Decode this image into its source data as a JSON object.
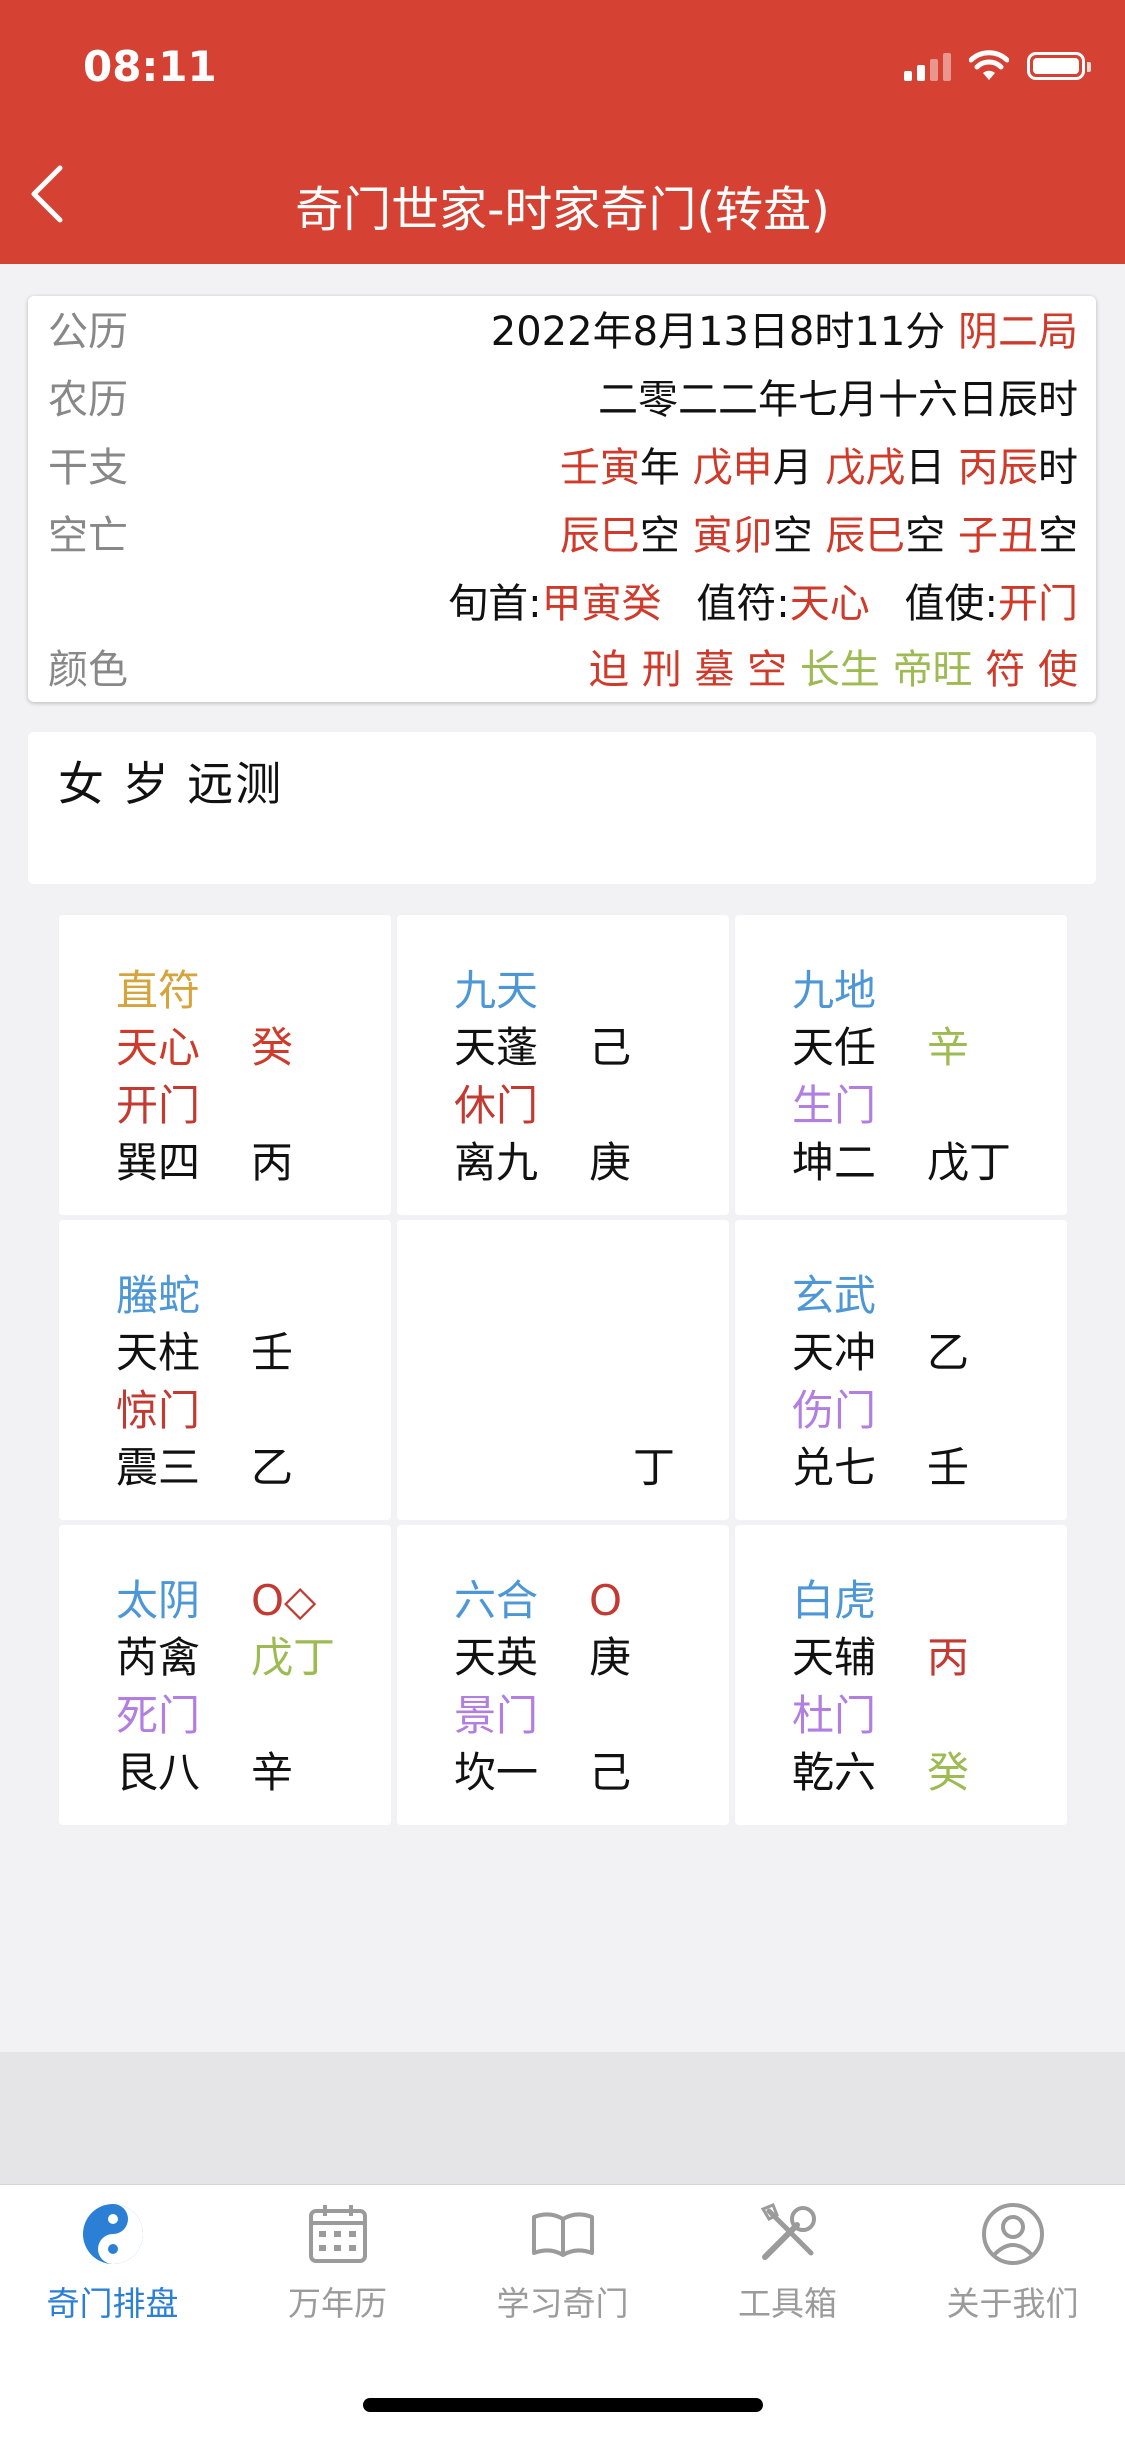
{
  "status_bar": {
    "time": "08:11"
  },
  "header": {
    "title": "奇门世家-时家奇门(转盘)"
  },
  "info": {
    "solar": {
      "label": "公历",
      "value": "2022年8月13日8时11分",
      "ju": "阴二局"
    },
    "lunar": {
      "label": "农历",
      "value": "二零二二年七月十六日辰时"
    },
    "ganzhi": {
      "label": "干支",
      "year": "壬寅",
      "year_unit": "年",
      "month": "戊申",
      "month_unit": "月",
      "day": "戊戌",
      "day_unit": "日",
      "hour": "丙辰",
      "hour_unit": "时"
    },
    "kongwang": {
      "label": "空亡",
      "items": [
        "辰巳",
        "寅卯",
        "辰巳",
        "子丑"
      ],
      "suffix": "空"
    },
    "xun": {
      "xunshou_label": "旬首:",
      "xunshou": "甲寅癸",
      "zhifu_label": "值符:",
      "zhifu": "天心",
      "zhishi_label": "值使:",
      "zhishi": "开门"
    },
    "colors": {
      "label": "颜色",
      "items": [
        "迫",
        "刑",
        "墓",
        "空",
        "长生",
        "帝旺",
        "符",
        "使"
      ]
    }
  },
  "question": "女 岁 远测",
  "palaces": [
    {
      "god": "直符",
      "star": "天心",
      "star_stem": "癸",
      "door": "开门",
      "palace": "巽四",
      "stem": "丙"
    },
    {
      "god": "九天",
      "star": "天蓬",
      "star_stem": "己",
      "door": "休门",
      "palace": "离九",
      "stem": "庚"
    },
    {
      "god": "九地",
      "star": "天任",
      "star_stem": "辛",
      "door": "生门",
      "palace": "坤二",
      "stem": "戊丁"
    },
    {
      "god": "螣蛇",
      "star": "天柱",
      "star_stem": "壬",
      "door": "惊门",
      "palace": "震三",
      "stem": "乙"
    },
    {
      "center_stem": "丁"
    },
    {
      "god": "玄武",
      "star": "天冲",
      "star_stem": "乙",
      "door": "伤门",
      "palace": "兑七",
      "stem": "壬"
    },
    {
      "god": "太阴",
      "mark": "O◇",
      "star": "芮禽",
      "star_stem": "戊丁",
      "door": "死门",
      "palace": "艮八",
      "stem": "辛"
    },
    {
      "god": "六合",
      "mark": "O",
      "star": "天英",
      "star_stem": "庚",
      "door": "景门",
      "palace": "坎一",
      "stem": "己"
    },
    {
      "god": "白虎",
      "star": "天辅",
      "star_stem": "丙",
      "door": "杜门",
      "palace": "乾六",
      "stem": "癸"
    }
  ],
  "tabs": [
    {
      "label": "奇门排盘",
      "icon": "yin-yang-icon",
      "active": true
    },
    {
      "label": "万年历",
      "icon": "calendar-icon"
    },
    {
      "label": "学习奇门",
      "icon": "book-icon"
    },
    {
      "label": "工具箱",
      "icon": "tools-icon"
    },
    {
      "label": "关于我们",
      "icon": "user-circle-icon"
    }
  ],
  "colors": {
    "header_bg": "#d54132",
    "red": "#cf3a2a",
    "green": "#9dbb52",
    "god_blue": "#4e97d6",
    "zhifu_gold": "#d6a43c",
    "door_purple": "#b27fe0",
    "tab_active": "#2b7fd4"
  }
}
